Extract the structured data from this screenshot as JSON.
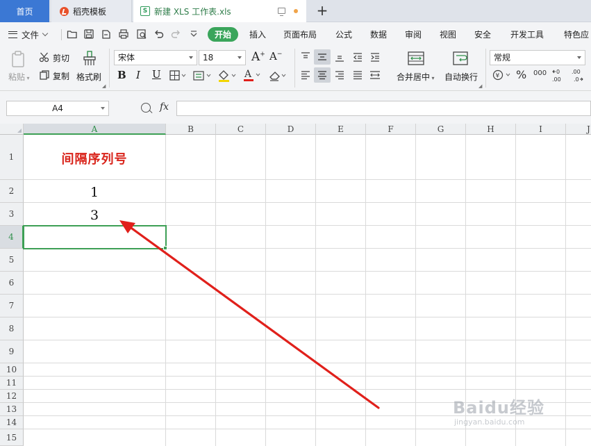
{
  "tabs": [
    {
      "label": "首页",
      "active": false
    },
    {
      "label": "稻壳模板",
      "active": false
    },
    {
      "label": "新建 XLS 工作表.xls",
      "active": true
    }
  ],
  "menu": {
    "file_label": "文件",
    "items": [
      "开始",
      "插入",
      "页面布局",
      "公式",
      "数据",
      "审阅",
      "视图",
      "安全",
      "开发工具",
      "特色应"
    ]
  },
  "ribbon": {
    "paste": "粘贴",
    "cut": "剪切",
    "copy": "复制",
    "format_painter": "格式刷",
    "font_name": "宋体",
    "font_size": "18",
    "merge_center": "合并居中",
    "wrap_text": "自动换行",
    "number_format": "常规",
    "percent_glyph": "%",
    "thousands_glyph": "000"
  },
  "formula_bar": {
    "name_box": "A4",
    "fx": "fx",
    "formula": ""
  },
  "sheet": {
    "columns": [
      "A",
      "B",
      "C",
      "D",
      "E",
      "F",
      "G",
      "H",
      "I",
      "J"
    ],
    "rows": [
      "1",
      "2",
      "3",
      "4",
      "5",
      "6",
      "7",
      "8",
      "9",
      "10",
      "11",
      "12",
      "13",
      "14",
      "15"
    ],
    "active_cell": "A4",
    "cells": {
      "A1": "间隔序列号",
      "A2": "1",
      "A3": "3"
    }
  },
  "colors": {
    "accent_green": "#3d9f55",
    "title_red": "#d9241b",
    "arrow_red": "#e0201b",
    "home_tab_blue": "#3b78d4"
  },
  "watermark": {
    "brand": "Baidu经验",
    "url": "jingyan.baidu.com"
  }
}
